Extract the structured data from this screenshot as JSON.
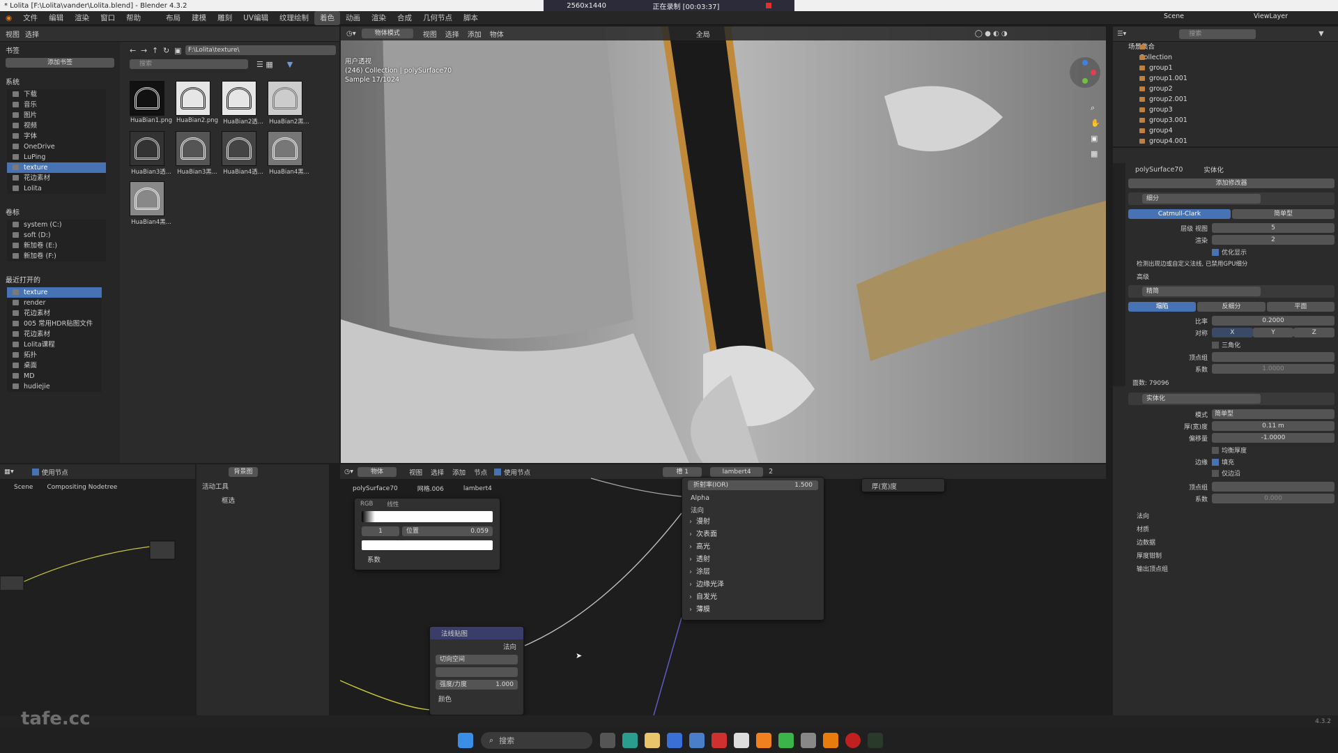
{
  "titlebar": {
    "title": "* Lolita [F:\\Lolita\\vander\\Lolita.blend] - Blender 4.3.2",
    "resolution": "2560x1440",
    "recording": "正在录制 [00:03:37]"
  },
  "menu": [
    "文件",
    "编辑",
    "渲染",
    "窗口",
    "帮助"
  ],
  "workspaces": [
    "布局",
    "建模",
    "雕刻",
    "UV编辑",
    "纹理绘制",
    "着色",
    "动画",
    "渲染",
    "合成",
    "几何节点",
    "脚本"
  ],
  "filebrowser": {
    "header": [
      "视图",
      "选择"
    ],
    "path": "F:\\Lolita\\texture\\",
    "search_placeholder": "搜索",
    "bookmarks_title": "书签",
    "add_bookmark": "添加书签",
    "system_title": "系统",
    "system_items": [
      "下载",
      "音乐",
      "图片",
      "视频",
      "字体",
      "OneDrive",
      "LuPing",
      "texture",
      "花边素材",
      "Lolita"
    ],
    "volumes_title": "卷标",
    "volumes": [
      "system (C:)",
      "soft (D:)",
      "新加卷 (E:)",
      "新加卷 (F:)"
    ],
    "recent_title": "最近打开的",
    "recent": [
      "texture",
      "render",
      "花边素材",
      "005 常用HDR贴图文件",
      "花边素材",
      "Lolita课程",
      "拓扑",
      "桌面",
      "MD",
      "hudiejie"
    ],
    "files": [
      "HuaBian1.png",
      "HuaBian2.png",
      "HuaBian2透...",
      "HuaBian2黑...",
      "HuaBian3透...",
      "HuaBian3黑...",
      "HuaBian4透...",
      "HuaBian4黑...",
      "HuaBian4黑..."
    ]
  },
  "viewport": {
    "mode": "物体模式",
    "menus": [
      "视图",
      "选择",
      "添加",
      "物体"
    ],
    "global": "全局",
    "overlay_text": [
      "用户透视",
      "(246) Collection | polySurface70",
      "Sample 17/1024"
    ]
  },
  "outliner": {
    "scene": "Scene",
    "viewlayer": "ViewLayer",
    "search_placeholder": "搜索",
    "root": "场景集合",
    "collection": "Collection",
    "items": [
      "group1",
      "group1.001",
      "group2",
      "group2.001",
      "group3",
      "group3.001",
      "group4",
      "group4.001"
    ]
  },
  "properties": {
    "object": "polySurface70",
    "tab": "实体化",
    "add_modifier": "添加修改器",
    "subdiv": {
      "name": "细分",
      "catmull": "Catmull-Clark",
      "simple": "简单型",
      "viewport_label": "层级 视图",
      "viewport_val": "5",
      "render_label": "渲染",
      "render_val": "2",
      "optimal": "优化显示",
      "warning": "检测出现边或自定义法线, 已禁用GPU细分",
      "advanced": "高级"
    },
    "decimate": {
      "name": "精简",
      "tabs": [
        "塌陷",
        "反细分",
        "平面"
      ],
      "ratio_label": "比率",
      "ratio_val": "0.2000",
      "sym_label": "对称",
      "sym_axes": [
        "X",
        "Y",
        "Z"
      ],
      "triangulate": "三角化",
      "vgroup_label": "顶点组",
      "factor_label": "系数",
      "factor_val": "1.0000",
      "face_count": "面数: 79096"
    },
    "solidify": {
      "name": "实体化",
      "mode_label": "模式",
      "mode_val": "简单型",
      "thickness_label": "厚(宽)度",
      "thickness_val": "0.11 m",
      "offset_label": "偏移量",
      "offset_val": "-1.0000",
      "even": "均衡厚度",
      "rim_label": "边缘",
      "fill": "填充",
      "rim_only": "仅边沿",
      "vgroup_label": "顶点组",
      "factor_label": "系数",
      "factor_val": "0.000",
      "subs": [
        "法向",
        "材质",
        "边数据",
        "厚度钳制",
        "输出顶点组"
      ]
    }
  },
  "compositor": {
    "use_nodes": "使用节点",
    "backdrop": "背景图",
    "breadcrumb": [
      "Scene",
      "Compositing Nodetree"
    ],
    "tools_title": "活动工具",
    "tool": "框选"
  },
  "shader": {
    "menus": [
      "物体",
      "视图",
      "选择",
      "添加",
      "节点"
    ],
    "use_nodes": "使用节点",
    "slot": "槽 1",
    "material": "lambert4",
    "users": "2",
    "breadcrumb": [
      "polySurface70",
      "网格.006",
      "lambert4"
    ],
    "ramp": {
      "tabs": [
        "RGB",
        "线性"
      ],
      "index": "1",
      "pos_label": "位置",
      "pos_val": "0.059",
      "factor": "系数"
    },
    "bsdf": {
      "ior_label": "折射率(IOR)",
      "ior_val": "1.500",
      "alpha": "Alpha",
      "normal": "法向",
      "subs": [
        "漫射",
        "次表面",
        "高光",
        "透射",
        "涂层",
        "边缘光泽",
        "自发光",
        "薄膜"
      ]
    },
    "thickness": "厚(宽)度",
    "normalmap": {
      "title": "法线贴图",
      "out": "法向",
      "space": "切向空间",
      "strength_label": "强度/力度",
      "strength_val": "1.000",
      "color": "颜色"
    }
  },
  "status": {
    "version": "4.3.2",
    "watermark": "tafe.cc"
  },
  "taskbar": {
    "search": "搜索"
  }
}
